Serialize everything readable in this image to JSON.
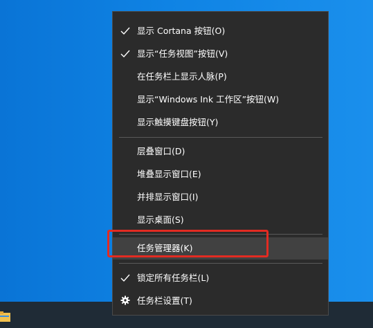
{
  "menu": {
    "items": [
      {
        "label": "显示 Cortana 按钮(O)",
        "checked": true
      },
      {
        "label": "显示“任务视图”按钮(V)",
        "checked": true
      },
      {
        "label": "在任务栏上显示人脉(P)",
        "checked": false
      },
      {
        "label": "显示“Windows Ink 工作区”按钮(W)",
        "checked": false
      },
      {
        "label": "显示触摸键盘按钮(Y)",
        "checked": false
      },
      {
        "label": "层叠窗口(D)"
      },
      {
        "label": "堆叠显示窗口(E)"
      },
      {
        "label": "并排显示窗口(I)"
      },
      {
        "label": "显示桌面(S)"
      },
      {
        "label": "任务管理器(K)",
        "hovered": true
      },
      {
        "label": "锁定所有任务栏(L)",
        "checked": true
      },
      {
        "label": "任务栏设置(T)",
        "icon": "gear-icon"
      }
    ]
  },
  "colors": {
    "menu_bg": "#2b2b2b",
    "hover_bg": "#414141",
    "highlight_outline": "#e32b22",
    "desktop_blue": "#0f83e4",
    "taskbar": "#1f2b36"
  }
}
